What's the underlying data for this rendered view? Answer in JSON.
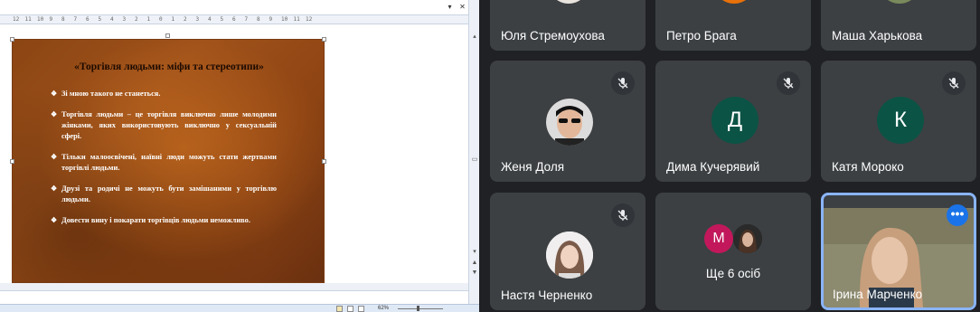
{
  "editor": {
    "zoom": "62%",
    "ruler_ticks": [
      "12",
      "11",
      "10",
      "9",
      "8",
      "7",
      "6",
      "5",
      "4",
      "3",
      "2",
      "1",
      "0",
      "1",
      "2",
      "3",
      "4",
      "5",
      "6",
      "7",
      "8",
      "9",
      "10",
      "11",
      "12"
    ],
    "slide": {
      "title": "«Торгівля людьми: міфи та стереотипи»",
      "bullets": [
        "Зі мною такого не станеться.",
        "Торгівля людьми – це торгівля виключно лише молодими жінками, яких використовують виключно у сексуальній сфері.",
        "Тільки малоосвічені, наївні люди можуть стати жертвами торгівлі людьми.",
        "Друзі та родичі не можуть бути замішаними у торгівлю людьми.",
        "Довести вину і покарати торгівців людьми неможливо."
      ],
      "bullet_mark": "❖",
      "colors": {
        "background": "#9a4a16",
        "title": "#1c0a02",
        "text": "#ffffff"
      }
    }
  },
  "meeting": {
    "participants": [
      {
        "name": "Юля Стремоухова",
        "type": "partial-video"
      },
      {
        "name": "Петро Брага",
        "type": "partial-avatar",
        "color": "#e8710a"
      },
      {
        "name": "Маша Харькова",
        "type": "partial-video"
      },
      {
        "name": "Женя Доля",
        "type": "photo",
        "muted": true
      },
      {
        "name": "Дима Кучерявий",
        "type": "letter",
        "letter": "Д",
        "color": "#0b5345",
        "muted": true
      },
      {
        "name": "Катя Мороко",
        "type": "letter",
        "letter": "К",
        "color": "#0b5345",
        "muted": true
      },
      {
        "name": "Настя Черненко",
        "type": "photo",
        "muted": true
      },
      {
        "name": "Ще 6 осіб",
        "type": "overflow",
        "letter": "М",
        "color": "#c2185b"
      },
      {
        "name": "Ірина Марченко",
        "type": "video",
        "active": true
      }
    ],
    "more_options_icon": "more-horiz-icon",
    "mute_icon": "mic-off-icon",
    "accent": "#8ab4f8",
    "more_button_color": "#1a73e8"
  }
}
